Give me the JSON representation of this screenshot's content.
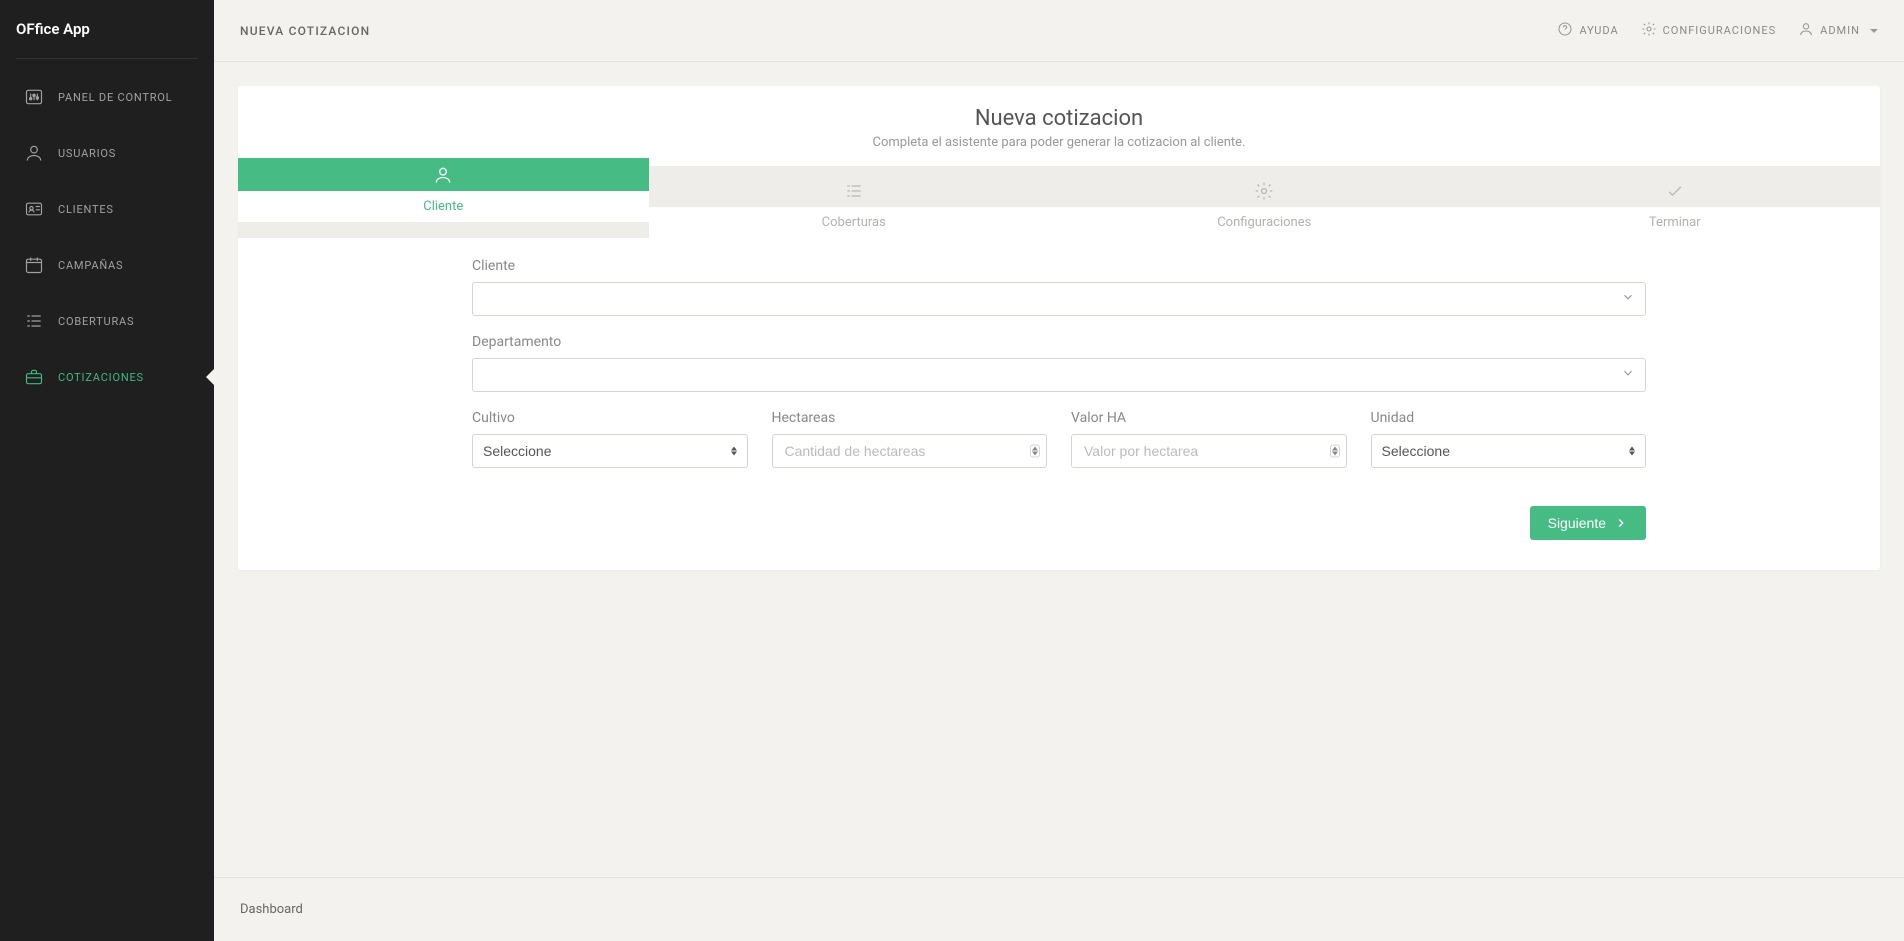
{
  "app_name": "OFfice App",
  "sidebar": {
    "items": [
      {
        "label": "PANEL DE CONTROL",
        "name": "sidebar-item-panel-de-control",
        "icon": "sliders"
      },
      {
        "label": "USUARIOS",
        "name": "sidebar-item-usuarios",
        "icon": "user"
      },
      {
        "label": "CLIENTES",
        "name": "sidebar-item-clientes",
        "icon": "id-card"
      },
      {
        "label": "CAMPAÑAS",
        "name": "sidebar-item-campanas",
        "icon": "calendar"
      },
      {
        "label": "COBERTURAS",
        "name": "sidebar-item-coberturas",
        "icon": "list"
      },
      {
        "label": "COTIZACIONES",
        "name": "sidebar-item-cotizaciones",
        "icon": "briefcase",
        "active": true
      }
    ]
  },
  "topbar": {
    "title": "NUEVA COTIZACION",
    "help_label": "AYUDA",
    "settings_label": "CONFIGURACIONES",
    "user_label": "ADMIN"
  },
  "wizard": {
    "title": "Nueva cotizacion",
    "subtitle": "Completa el asistente para poder generar la cotizacion al cliente.",
    "steps": [
      {
        "label": "Cliente",
        "icon": "user",
        "active": true
      },
      {
        "label": "Coberturas",
        "icon": "list",
        "active": false
      },
      {
        "label": "Configuraciones",
        "icon": "gear",
        "active": false
      },
      {
        "label": "Terminar",
        "icon": "check",
        "active": false
      }
    ]
  },
  "form": {
    "cliente_label": "Cliente",
    "departamento_label": "Departamento",
    "cultivo_label": "Cultivo",
    "cultivo_selected": "Seleccione",
    "hectareas_label": "Hectareas",
    "hectareas_placeholder": "Cantidad de hectareas",
    "valor_ha_label": "Valor HA",
    "valor_ha_placeholder": "Valor por hectarea",
    "unidad_label": "Unidad",
    "unidad_selected": "Seleccione",
    "next_button": "Siguiente"
  },
  "footer": {
    "text": "Dashboard"
  },
  "colors": {
    "accent": "#46bb84",
    "sidebar_bg": "#1f1f1f",
    "page_bg": "#f3f2ee"
  }
}
